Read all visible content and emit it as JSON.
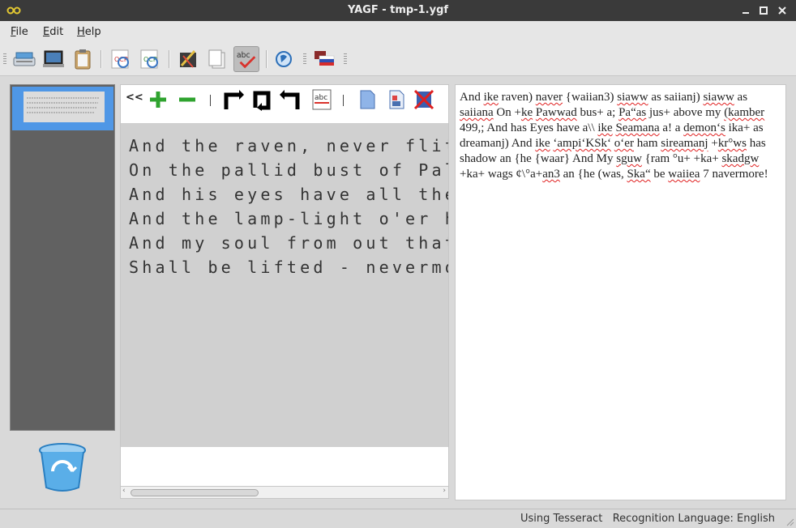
{
  "window": {
    "title": "YAGF - tmp-1.ygf"
  },
  "menu": {
    "file": "File",
    "file_mnemonic": "F",
    "file_rest": "ile",
    "edit_mnemonic": "E",
    "edit_rest": "dit",
    "help_mnemonic": "H",
    "help_rest": "elp"
  },
  "toolbar": {
    "icons": [
      "scanner-icon",
      "open-image-icon",
      "paste-icon",
      "ocr-icon",
      "ocr-selection-icon",
      "edit-tool-icon",
      "copy-icon",
      "spellcheck-icon",
      "web-icon",
      "language-flag-icon"
    ]
  },
  "image_toolbar": {
    "collapse_label": "<<",
    "spell_label": "abc"
  },
  "image_lines": [
    "And the raven, never flittin",
    "On the pallid bust of Pallas",
    "And his eyes have all the se",
    "And the lamp-light o'er him",
    "And my soul from out that sh",
    "Shall be lifted - nevermore!"
  ],
  "ocr_text": [
    {
      "t": "And "
    },
    {
      "t": "ike",
      "sp": true
    },
    {
      "t": " raven) "
    },
    {
      "t": "naver",
      "sp": true
    },
    {
      "t": " {waiian3) "
    },
    {
      "t": "siaww",
      "sp": true
    },
    {
      "t": " as saiianj) "
    },
    {
      "t": "siaww",
      "sp": true
    },
    {
      "t": " as "
    },
    {
      "t": "saiiana",
      "sp": true
    },
    {
      "t": " On +"
    },
    {
      "t": "ke",
      "sp": true
    },
    {
      "t": " "
    },
    {
      "t": "Pawwad",
      "sp": true
    },
    {
      "t": " bus+ a; "
    },
    {
      "t": "Pa“as",
      "sp": true
    },
    {
      "t": " jus+ above my "
    },
    {
      "t": "(kamber",
      "sp": true
    },
    {
      "t": " 499,; And has Eyes have a\\\\ "
    },
    {
      "t": "ike",
      "sp": true
    },
    {
      "t": " "
    },
    {
      "t": "Seamana",
      "sp": true
    },
    {
      "t": " a! a "
    },
    {
      "t": "demon‘s",
      "sp": true
    },
    {
      "t": " ika+ as dreamanj) And "
    },
    {
      "t": "ike",
      "sp": true
    },
    {
      "t": " "
    },
    {
      "t": "‘ampi‘KSk‘",
      "sp": true
    },
    {
      "t": " "
    },
    {
      "t": "o‘er",
      "sp": true
    },
    {
      "t": " ham "
    },
    {
      "t": "sireamanj",
      "sp": true
    },
    {
      "t": " +"
    },
    {
      "t": "kr°ws",
      "sp": true
    },
    {
      "t": " has shadow an {he {waar} And My "
    },
    {
      "t": "sguw",
      "sp": true
    },
    {
      "t": " "
    },
    {
      "t": "{ram °u+ +ka+ "
    },
    {
      "t": "skadgw",
      "sp": true
    },
    {
      "t": " +ka+ wags ¢\\°a+"
    },
    {
      "t": "an3",
      "sp": true
    },
    {
      "t": " an {he (was, "
    },
    {
      "t": "Ska“",
      "sp": true
    },
    {
      "t": " be "
    },
    {
      "t": "waiiea",
      "sp": true
    },
    {
      "t": " 7 navermore!"
    }
  ],
  "status": {
    "text": "Using Tesseract   Recognition Language: English"
  },
  "colors": {
    "selection": "#4f97e6",
    "titlebar": "#3a3a3a",
    "spell_error": "#e02020"
  }
}
